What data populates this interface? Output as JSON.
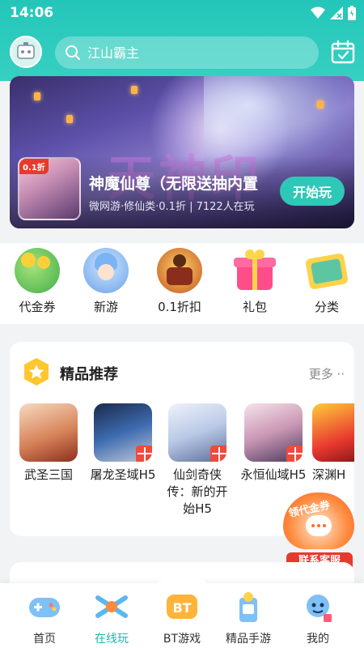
{
  "status_bar": {
    "time": "14:06"
  },
  "search": {
    "placeholder": "江山霸主"
  },
  "banner": {
    "thumb_tag": "0.1折",
    "calligraphy": "天神印",
    "title": "神魔仙尊（无限送抽内置",
    "subtitle": "微网游·修仙类·0.1折 | 7122人在玩",
    "play_label": "开始玩"
  },
  "categories": [
    {
      "label": "代金券",
      "icon": "voucher-icon"
    },
    {
      "label": "新游",
      "icon": "new-game-icon"
    },
    {
      "label": "0.1折扣",
      "icon": "discount-icon"
    },
    {
      "label": "礼包",
      "icon": "gift-icon"
    },
    {
      "label": "分类",
      "icon": "category-icon"
    }
  ],
  "recommended": {
    "title": "精品推荐",
    "more": "更多 ··",
    "games": [
      {
        "name": "武圣三国",
        "gift": false
      },
      {
        "name": "屠龙圣域H5",
        "gift": true
      },
      {
        "name": "仙剑奇侠传：新的开始H5",
        "gift": true
      },
      {
        "name": "永恒仙域H5",
        "gift": true
      },
      {
        "name": "深渊H",
        "gift": false
      }
    ]
  },
  "service_badge": {
    "arc_text": "领代金券",
    "label": "联系客服"
  },
  "bottom_nav": [
    {
      "label": "首页",
      "icon": "gamepad-icon",
      "active": false
    },
    {
      "label": "在线玩",
      "icon": "online-play-icon",
      "active": true
    },
    {
      "label": "BT游戏",
      "icon": "bt-icon",
      "active": false
    },
    {
      "label": "精品手游",
      "icon": "mobile-game-icon",
      "active": false
    },
    {
      "label": "我的",
      "icon": "profile-icon",
      "active": false
    }
  ],
  "colors": {
    "accent": "#23c6b9",
    "play_button": "#2fc7b8",
    "nav_active": "#1fb8aa",
    "badge_red": "#e8392f"
  }
}
